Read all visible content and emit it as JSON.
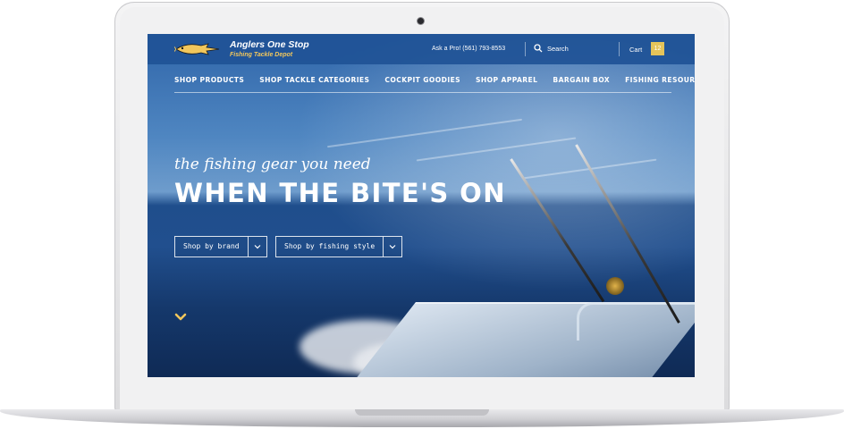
{
  "site": {
    "name": "Anglers One Stop",
    "subtitle": "Fishing Tackle Depot"
  },
  "header": {
    "ask_pro": "Ask a Pro! (561) 793-8553",
    "search_label": "Search",
    "cart_label": "Cart",
    "cart_count": "12"
  },
  "nav": {
    "items": [
      {
        "label": "SHOP PRODUCTS"
      },
      {
        "label": "SHOP TACKLE CATEGORIES"
      },
      {
        "label": "COCKPIT GOODIES"
      },
      {
        "label": "SHOP APPAREL"
      },
      {
        "label": "BARGAIN BOX"
      },
      {
        "label": "FISHING RESOURCES"
      }
    ]
  },
  "hero": {
    "tagline": "the fishing gear you need",
    "headline": "WHEN THE BITE'S ON",
    "dropdowns": [
      {
        "label": "Shop by brand"
      },
      {
        "label": "Shop by fishing style"
      }
    ]
  },
  "colors": {
    "header_bg": "#2052a0",
    "cart_badge": "#e5c45a",
    "accent_yellow": "#f2c75c"
  },
  "icons": [
    "fish-logo-icon",
    "search-icon",
    "chevron-down-icon",
    "scroll-down-icon",
    "camera-icon"
  ]
}
